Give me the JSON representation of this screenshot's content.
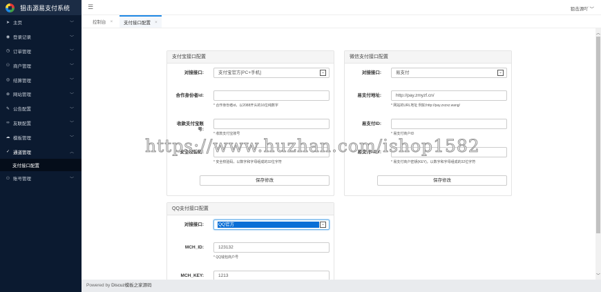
{
  "app": {
    "title": "狙击源易支付系统",
    "user": "狙击源吖"
  },
  "sidebar": {
    "items": [
      {
        "label": "主页",
        "icon": "send-icon"
      },
      {
        "label": "登录记录",
        "icon": "eye-icon"
      },
      {
        "label": "订单管理",
        "icon": "clock-icon"
      },
      {
        "label": "商户管理",
        "icon": "user-icon"
      },
      {
        "label": "结算管理",
        "icon": "target-icon"
      },
      {
        "label": "网站管理",
        "icon": "globe-icon"
      },
      {
        "label": "公告配置",
        "icon": "pencil-icon"
      },
      {
        "label": "友联配置",
        "icon": "link-icon"
      },
      {
        "label": "模板管理",
        "icon": "cloud-icon"
      },
      {
        "label": "通道管理",
        "icon": "shield-check-icon"
      }
    ],
    "sub_item": "支付接口配置",
    "last_item": {
      "label": "账号管理",
      "icon": "user-icon"
    }
  },
  "tabs": [
    {
      "label": "控制台"
    },
    {
      "label": "支付接口配置"
    }
  ],
  "alipay": {
    "title": "支付宝接口配置",
    "iface_label": "对接接口:",
    "iface_value": "支付宝官方[PC+手机]",
    "pid_label": "合作身份者id:",
    "pid_value": "",
    "pid_hint": "* 合作身份者id，以2088开头的16位纯数字",
    "acct_label": "收款支付宝账号:",
    "acct_value": "",
    "acct_hint": "* 收款支付宝账号",
    "key_label": "安全校验码:",
    "key_value": "",
    "key_hint": "* 安全校验码，以数字和字母组成的32位字符",
    "save": "保存修改"
  },
  "wechat": {
    "title": "微信支付接口配置",
    "iface_label": "对接接口:",
    "iface_value": "易支付",
    "url_label": "易支付地址:",
    "url_value": "http://pay.zmyzf.cn/",
    "url_hint": "* 网站的URL地址 例如:http://pay.zxzxz.wang/",
    "id_label": "易支付ID:",
    "id_value": "",
    "id_hint": "* 易支付商户ID",
    "key_label": "易支付KEY:",
    "key_value": "",
    "key_hint": "* 易支付商户密钥(KEY)，以数字和字母组成的32位字符",
    "save": "保存修改"
  },
  "qq": {
    "title": "QQ支付接口配置",
    "iface_label": "对接接口:",
    "iface_value": "QQ官方",
    "mchid_label": "MCH_ID:",
    "mchid_value": "123132",
    "mchid_hint": "* QQ钱包商户号",
    "mchkey_label": "MCH_KEY:",
    "mchkey_value": "1213"
  },
  "footer": {
    "prefix": "Powered by",
    "brand": "Discuz模板之家源码"
  },
  "watermark": "https://www.huzhan.com/ishop1582"
}
